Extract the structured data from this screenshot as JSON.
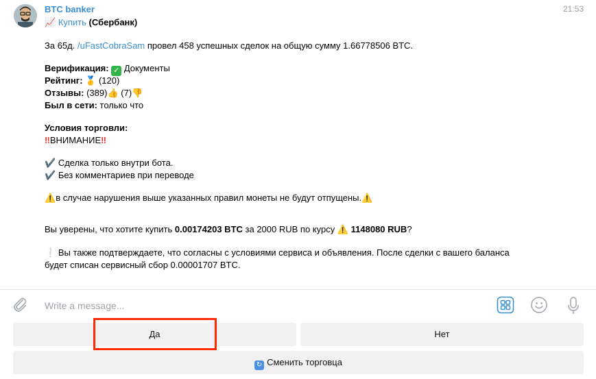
{
  "message": {
    "sender": "BTC banker",
    "time": "21:53",
    "reply": {
      "icon": "chart-up-icon",
      "action": "Купить",
      "bank": "(Сбербанк)"
    },
    "summary": {
      "prefix": "За 65д.",
      "user_link": "/uFastCobraSam",
      "text": "провел 458 успешных сделок на общую сумму 1.66778506 BTC."
    },
    "verification": {
      "label": "Верификация:",
      "value": "Документы"
    },
    "rating": {
      "label": "Рейтинг:",
      "value": "(120)"
    },
    "reviews": {
      "label": "Отзывы:",
      "positive": "(389)",
      "negative": "(7)"
    },
    "last_seen": {
      "label": "Был в сети:",
      "value": "только что"
    },
    "terms": {
      "title": "Условия торговли:",
      "attention": "ВНИМАНИЕ",
      "rule1": "Сделка только внутри бота.",
      "rule2": "Без комментариев при переводе",
      "warning": "в случае нарушения выше указанных правил монеты не будут отпущены."
    },
    "confirm": {
      "prefix": "Вы уверены, что хотите купить ",
      "amount": "0.00174203 BTC",
      "middle": " за 2000 RUB по курсу ",
      "rate": "1148080 RUB",
      "suffix": "?"
    },
    "fee_line1": "Вы также подтверждаете, что согласны с условиями сервиса и объявления. После сделки с вашего баланса",
    "fee_line2": "будет списан сервисный сбор 0.00001707 BTC."
  },
  "composer": {
    "placeholder": "Write a message..."
  },
  "keyboard": {
    "yes": "Да",
    "no": "Нет",
    "change_trader": "Сменить торговца"
  }
}
